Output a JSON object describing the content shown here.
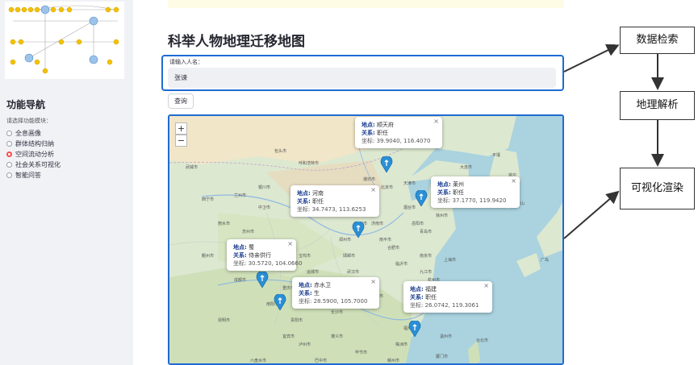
{
  "sidebar": {
    "nav_title": "功能导航",
    "nav_hint": "请选择功能模块：",
    "options": [
      {
        "label": "全息画像",
        "selected": false
      },
      {
        "label": "群体结构归纳",
        "selected": false
      },
      {
        "label": "空间流动分析",
        "selected": true
      },
      {
        "label": "社会关系可视化",
        "selected": false
      },
      {
        "label": "智能问答",
        "selected": false
      }
    ]
  },
  "main": {
    "title": "科举人物地理迁移地图",
    "search": {
      "label": "请输入人名：",
      "value": "张谏"
    },
    "query_button": "查询"
  },
  "map": {
    "zoom_in": "+",
    "zoom_out": "−",
    "popups": [
      {
        "place_label": "地点:",
        "place": "顺天府",
        "rel_label": "关系:",
        "rel": "职任",
        "coord_label": "坐标:",
        "coord": "39.9040, 116.4070"
      },
      {
        "place_label": "地点:",
        "place": "莱州",
        "rel_label": "关系:",
        "rel": "职任",
        "coord_label": "坐标:",
        "coord": "37.1770, 119.9420"
      },
      {
        "place_label": "地点:",
        "place": "河南",
        "rel_label": "关系:",
        "rel": "职任",
        "coord_label": "坐标:",
        "coord": "34.7473, 113.6253"
      },
      {
        "place_label": "地点:",
        "place": "蜀",
        "rel_label": "关系:",
        "rel": "侍亲供行",
        "coord_label": "坐标:",
        "coord": "30.5720, 104.0660"
      },
      {
        "place_label": "地点:",
        "place": "赤水卫",
        "rel_label": "关系:",
        "rel": "生",
        "coord_label": "坐标:",
        "coord": "28.5900, 105.7000"
      },
      {
        "place_label": "地点:",
        "place": "福建",
        "rel_label": "关系:",
        "rel": "职任",
        "coord_label": "坐标:",
        "coord": "26.0742, 119.3061"
      }
    ],
    "close_glyph": "×",
    "base_labels": [
      "包头市",
      "呼和浩特市",
      "天津市",
      "北京市",
      "太原市",
      "石家庄市",
      "济南市",
      "青岛市",
      "郑州市",
      "西安市",
      "武汉市",
      "南京市",
      "上海市",
      "杭州市",
      "成都市",
      "重庆市",
      "长沙市",
      "南昌市",
      "福州市",
      "贵阳市",
      "昆明市",
      "西宁市",
      "兰州市",
      "银川市",
      "合肥市",
      "大连市",
      "宁波市",
      "温州市",
      "厦门市",
      "台北市",
      "首尔",
      "平壤",
      "釜山",
      "广岛",
      "武威市",
      "中卫市",
      "宝鸡市",
      "南阳市",
      "宜宾市",
      "泸州市",
      "遵义市",
      "株洲市",
      "赣州市",
      "南平市",
      "临沂市",
      "徐州市",
      "烟台市",
      "潍坊市",
      "德州市",
      "邯郸市",
      "运城市",
      "巴中市",
      "六盘水市",
      "毕节市",
      "宜昌市",
      "岳阳市",
      "九江市",
      "衢州市",
      "苏州市",
      "丽水市"
    ]
  },
  "annotations": {
    "steps": [
      "数据检索",
      "地理解析",
      "可视化渲染"
    ]
  },
  "colors": {
    "accent_blue": "#1f6bd1",
    "radio_selected": "#ff4b4b",
    "sidebar_bg": "#f0f2f6",
    "sea": "#aad3df",
    "land": "#dde8d0",
    "pin": "#2a8fd6"
  }
}
